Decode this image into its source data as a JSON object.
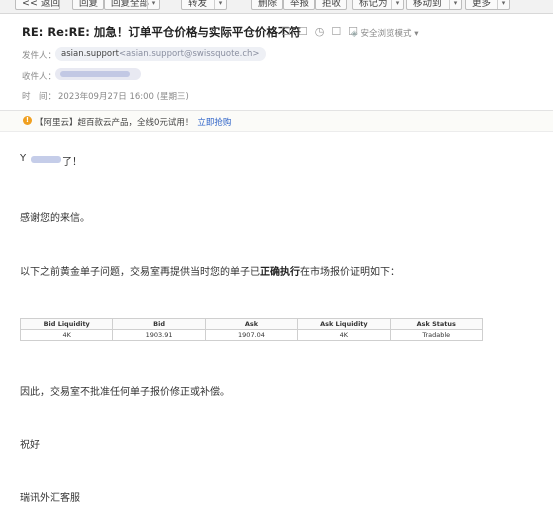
{
  "toolbar": {
    "buttons": [
      {
        "label": "<< 返回"
      },
      {
        "label": "回复"
      },
      {
        "label": "回复全部"
      },
      {
        "label": "转发"
      },
      {
        "label": "删除"
      },
      {
        "label": "举报"
      },
      {
        "label": "拒收"
      },
      {
        "label": "标记为"
      },
      {
        "label": "移动到"
      },
      {
        "label": "更多"
      }
    ]
  },
  "email": {
    "subject": "RE: Re:RE: 加急！订单平仓价格与实际平仓价格不符",
    "subject_icons": "☐☐◷☐☐",
    "security_label": "安全浏览模式",
    "from_label": "发件人：",
    "from_name": "asian.support",
    "from_addr": "<asian.support@swissquote.ch>",
    "to_label": "收件人：",
    "time_label": "时　间：",
    "time_value": "2023年09月27日 16:00 (星期三)"
  },
  "ad": {
    "text": "【阿里云】超百款云产品，全线0元试用！",
    "link": "立即抢购"
  },
  "body": {
    "greeting_suffix": "了！",
    "thanks": "感谢您的来信。",
    "intro_prefix": "以下之前黄金单子问题，交易室再提供当时您的单子已",
    "intro_bold": "正确执行",
    "intro_suffix": "在市场报价证明如下：",
    "conclusion": "因此，交易室不批准任何单子报价修正或补偿。",
    "closing": "祝好",
    "signature": "瑞讯外汇客服"
  },
  "table": {
    "headers": [
      "Bid Liquidity",
      "Bid",
      "Ask",
      "Ask Liquidity",
      "Ask Status"
    ],
    "rows": [
      [
        "4K",
        "1903.91",
        "1907.04",
        "4K",
        "Tradable"
      ]
    ]
  },
  "colors": {
    "link": "#2f64c8",
    "toolbar_bg": "#f2f2f2"
  }
}
